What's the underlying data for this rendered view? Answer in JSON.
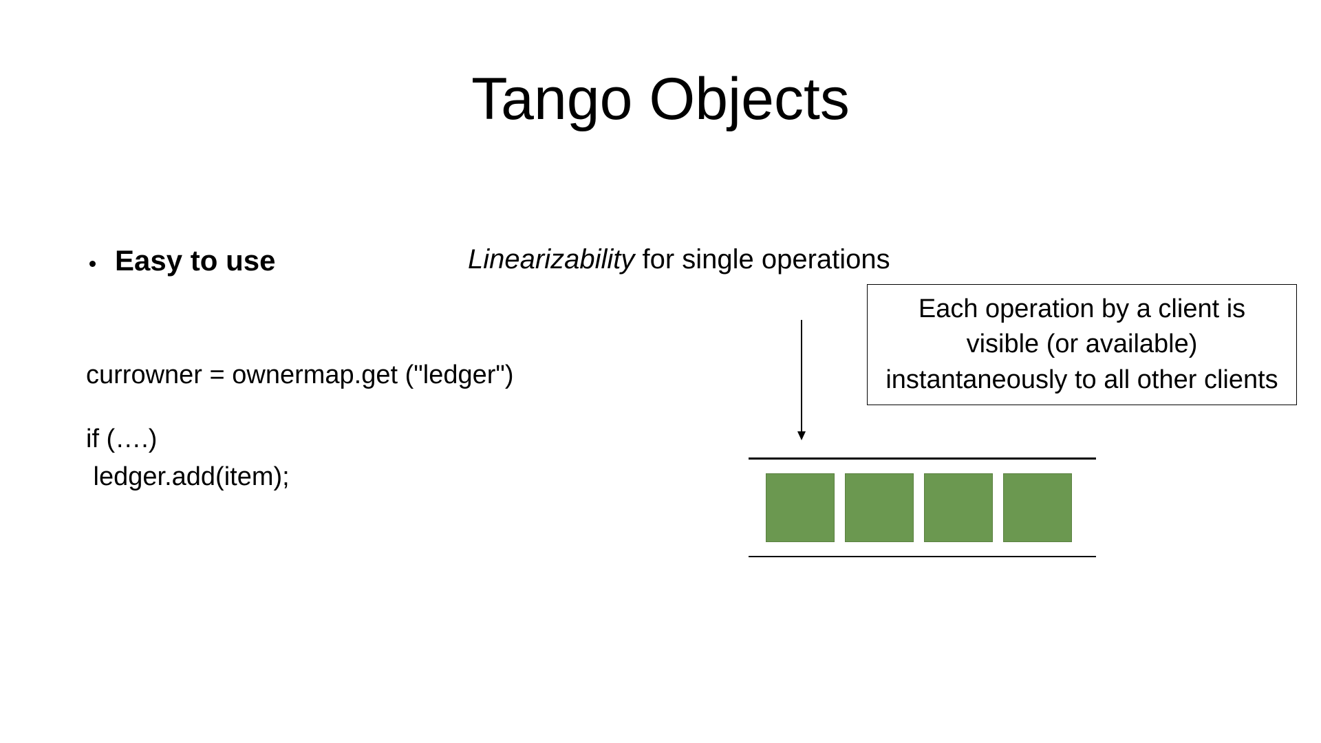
{
  "title": "Tango Objects",
  "bullet": "Easy to use",
  "subtitle_italic": "Linearizability",
  "subtitle_rest": " for single operations",
  "callout": "Each operation by a client is visible (or available) instantaneously to all other clients",
  "code": {
    "line1": "currowner = ownermap.get (\"ledger\")",
    "line2": "if (….)",
    "line3": " ledger.add(item);"
  },
  "colors": {
    "block": "#6b9850"
  }
}
